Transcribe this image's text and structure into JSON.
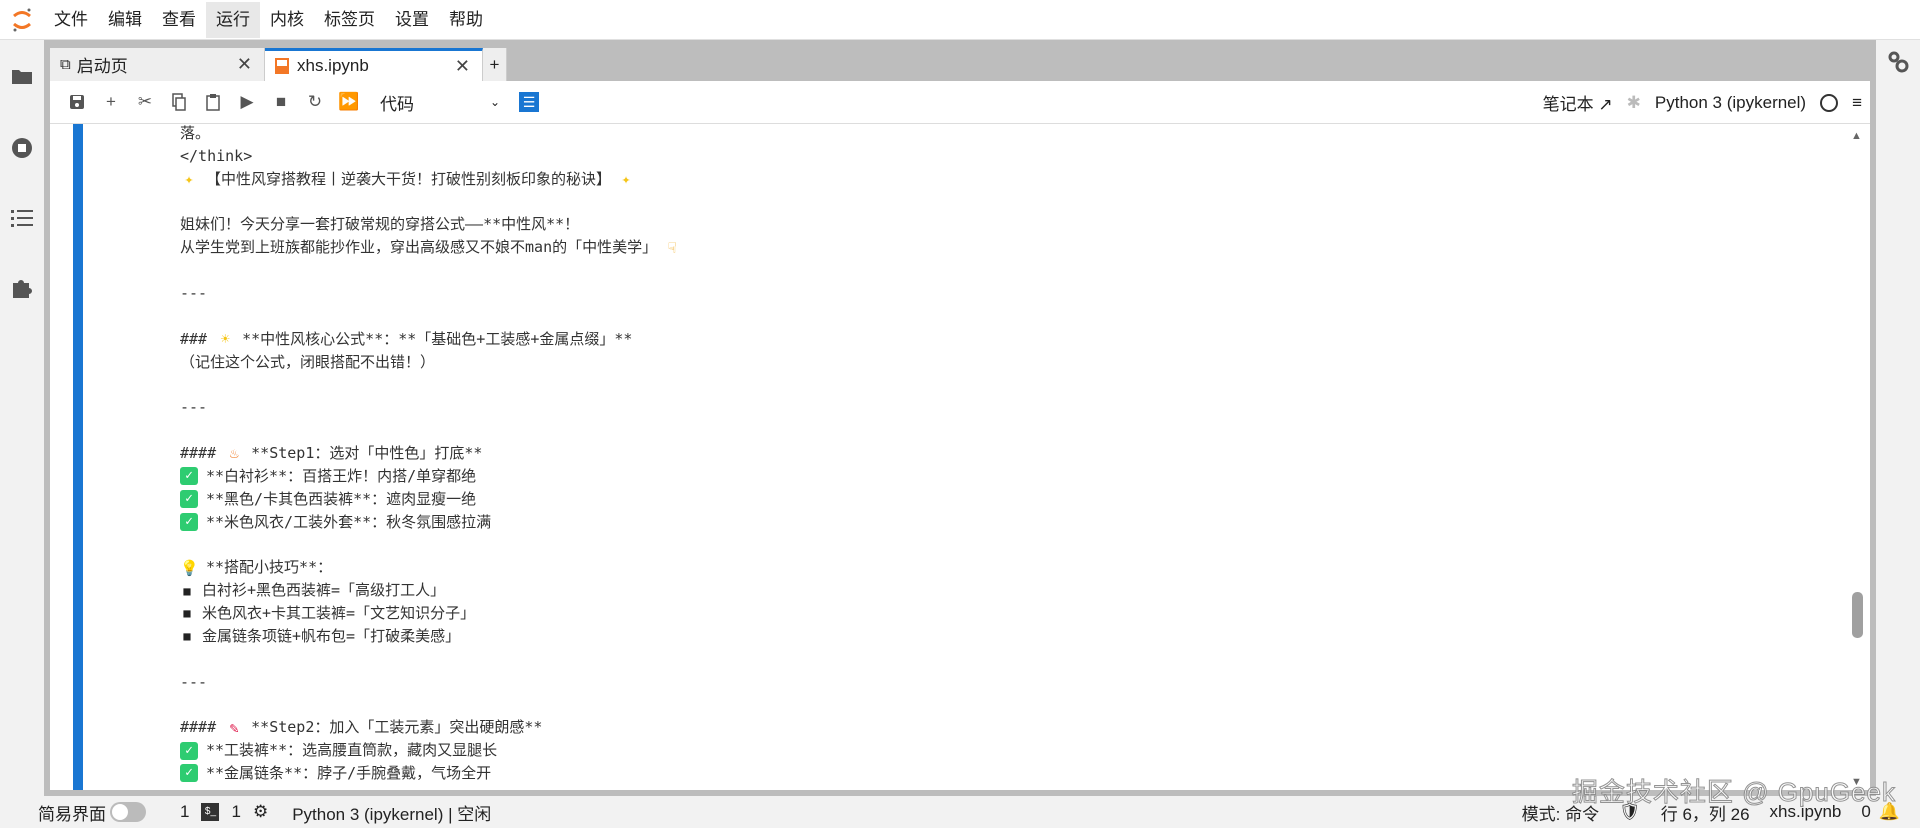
{
  "menu": [
    "文件",
    "编辑",
    "查看",
    "运行",
    "内核",
    "标签页",
    "设置",
    "帮助"
  ],
  "tabs": [
    {
      "label": "启动页",
      "icon": "launcher-icon"
    },
    {
      "label": "xhs.ipynb",
      "icon": "notebook-icon"
    }
  ],
  "toolbar": {
    "cell_type": "代码",
    "notebook_label": "笔记本",
    "kernel": "Python 3 (ipykernel)"
  },
  "lines": [
    {
      "text": "落。"
    },
    {
      "text": "</think>"
    },
    {
      "icon": "sparkle",
      "text": "【中性风穿搭教程丨逆袭大干货！打破性别刻板印象的秘诀】",
      "post_icon": "sparkle"
    },
    {
      "text": ""
    },
    {
      "text": "姐妹们！今天分享一套打破常规的穿搭公式——**中性风**！"
    },
    {
      "text": "从学生党到上班族都能抄作业，穿出高级感又不娘不man的「中性美学」",
      "post_icon": "hand"
    },
    {
      "text": ""
    },
    {
      "text": "---"
    },
    {
      "text": ""
    },
    {
      "pre": "### ",
      "icon": "sun",
      "text": "**中性风核心公式**：**「基础色+工装感+金属点缀」**"
    },
    {
      "text": "（记住这个公式，闭眼搭配不出错！）"
    },
    {
      "text": ""
    },
    {
      "text": "---"
    },
    {
      "text": ""
    },
    {
      "pre": "#### ",
      "icon": "fire",
      "text": "**Step1：选对「中性色」打底**"
    },
    {
      "icon": "check",
      "text": "**白衬衫**：百搭王炸！内搭/单穿都绝"
    },
    {
      "icon": "check",
      "text": "**黑色/卡其色西装裤**：遮肉显瘦一绝"
    },
    {
      "icon": "check",
      "text": "**米色风衣/工装外套**：秋冬氛围感拉满"
    },
    {
      "text": ""
    },
    {
      "icon": "bulb",
      "text": "**搭配小技巧**："
    },
    {
      "icon": "bullet",
      "text": "白衬衫+黑色西装裤=「高级打工人」"
    },
    {
      "icon": "bullet",
      "text": "米色风衣+卡其工装裤=「文艺知识分子」"
    },
    {
      "icon": "bullet",
      "text": "金属链条项链+帆布包=「打破柔美感」"
    },
    {
      "text": ""
    },
    {
      "text": "---"
    },
    {
      "text": ""
    },
    {
      "pre": "#### ",
      "icon": "memo",
      "text": "**Step2：加入「工装元素」突出硬朗感**"
    },
    {
      "icon": "check",
      "text": "**工装裤**：选高腰直筒款，藏肉又显腿长"
    },
    {
      "icon": "check",
      "text": "**金属链条**：脖子/手腕叠戴，气场全开"
    }
  ],
  "status": {
    "simple_mode": "简易界面",
    "terminals": "1",
    "kernels": "1",
    "kernel_status": "Python 3 (ipykernel) | 空闲",
    "mode": "模式: 命令",
    "position": "行 6，列 26",
    "file": "xhs.ipynb",
    "notifications": "0"
  },
  "watermark": "掘金技术社区 @ GpuGeek",
  "colors": {
    "accent": "#1976d2",
    "check": "#2ecc71"
  }
}
